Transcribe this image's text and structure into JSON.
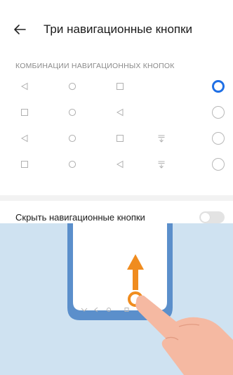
{
  "header": {
    "title": "Три навигационные кнопки",
    "back_icon": "arrow-left-icon"
  },
  "section": {
    "title": "КОМБИНАЦИИ НАВИГАЦИОННЫХ КНОПОК"
  },
  "combinations": [
    {
      "icons": [
        "back-triangle",
        "home-circle",
        "recent-square"
      ],
      "selected": true
    },
    {
      "icons": [
        "recent-square",
        "home-circle",
        "back-triangle"
      ],
      "selected": false
    },
    {
      "icons": [
        "back-triangle",
        "home-circle",
        "recent-square",
        "notification-pulldown"
      ],
      "selected": false
    },
    {
      "icons": [
        "recent-square",
        "home-circle",
        "back-triangle",
        "notification-pulldown"
      ],
      "selected": false
    }
  ],
  "toggle": {
    "label": "Скрыть навигационные кнопки",
    "checked": false
  },
  "colors": {
    "accent": "#1f6fe5",
    "icon": "#b0b0b0",
    "illustration_bg": "#cfe2f1",
    "phone_frame": "#5b8fcb",
    "swipe_arrow": "#f08c1f",
    "hand": "#f5b9a2"
  }
}
